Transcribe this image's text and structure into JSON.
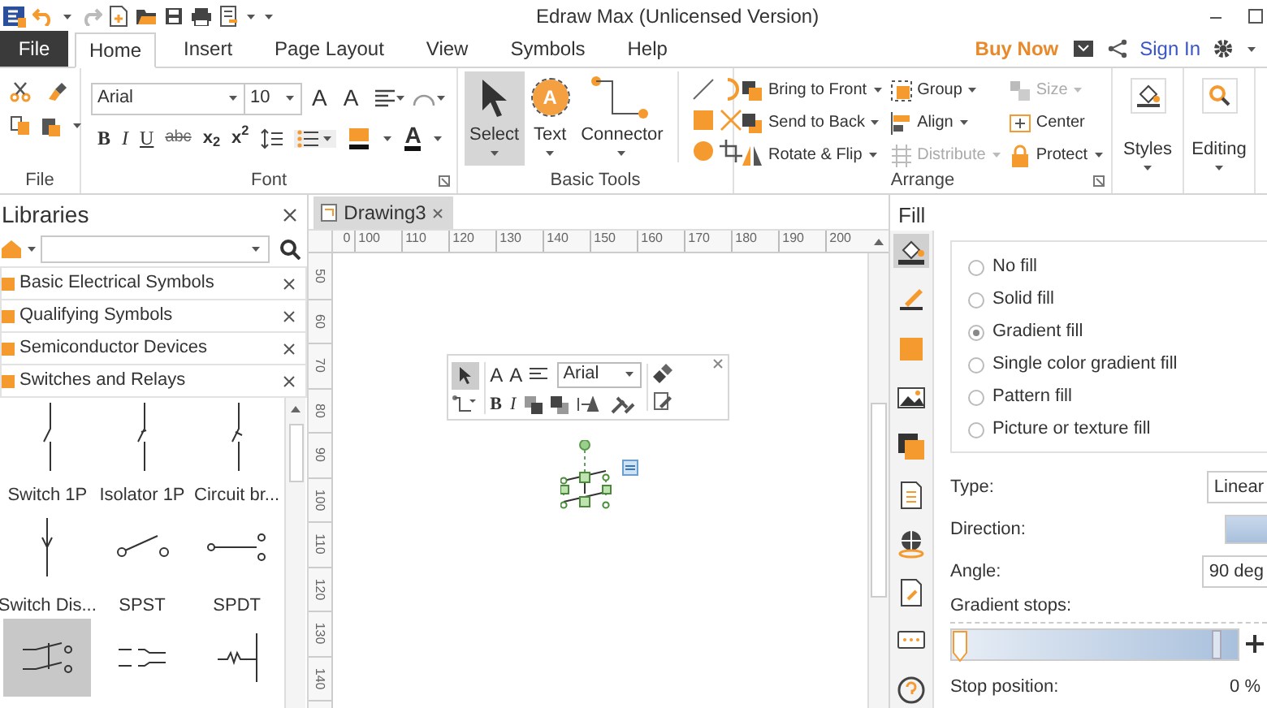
{
  "window": {
    "title": "Edraw Max (Unlicensed Version)"
  },
  "menu_tabs": [
    {
      "label": "File",
      "kind": "backstage",
      "selected": false
    },
    {
      "label": "Home",
      "kind": "tab",
      "selected": true
    },
    {
      "label": "Insert",
      "kind": "tab",
      "selected": false
    },
    {
      "label": "Page Layout",
      "kind": "tab",
      "selected": false
    },
    {
      "label": "View",
      "kind": "tab",
      "selected": false
    },
    {
      "label": "Symbols",
      "kind": "tab",
      "selected": false
    },
    {
      "label": "Help",
      "kind": "tab",
      "selected": false
    }
  ],
  "account": {
    "buy_now": "Buy Now",
    "sign_in": "Sign In"
  },
  "clipboard_group": {
    "label": "File"
  },
  "font_group": {
    "label": "Font",
    "family": "Arial",
    "size": "10",
    "size_buttons": [
      "A",
      "A"
    ],
    "format_buttons": [
      "B",
      "I",
      "U",
      "abc",
      "x$_{2}$",
      "x$^{2}$"
    ],
    "color_button": "A"
  },
  "basic_tools": {
    "label": "Basic Tools",
    "tools": [
      {
        "label": "Select",
        "kind": "pointer",
        "selected": true
      },
      {
        "label": "Text",
        "kind": "text",
        "glyph": "A",
        "selected": false
      },
      {
        "label": "Connector",
        "kind": "connector",
        "selected": false
      }
    ]
  },
  "arrange": {
    "label": "Arrange",
    "commands": [
      {
        "label": "Bring to Front",
        "dropdown": true,
        "disabled": false
      },
      {
        "label": "Group",
        "dropdown": true,
        "disabled": false
      },
      {
        "label": "Size",
        "dropdown": true,
        "disabled": true
      },
      {
        "label": "Send to Back",
        "dropdown": true,
        "disabled": false
      },
      {
        "label": "Align",
        "dropdown": true,
        "disabled": false
      },
      {
        "label": "Center",
        "dropdown": false,
        "disabled": false
      },
      {
        "label": "Rotate & Flip",
        "dropdown": true,
        "disabled": false
      },
      {
        "label": "Distribute",
        "dropdown": true,
        "disabled": true
      },
      {
        "label": "Protect",
        "dropdown": true,
        "disabled": false
      }
    ]
  },
  "styles": {
    "label": "Styles"
  },
  "editing": {
    "label": "Editing"
  },
  "libraries": {
    "title": "Libraries",
    "categories": [
      "Basic Electrical Symbols",
      "Qualifying Symbols",
      "Semiconductor Devices",
      "Switches and Relays"
    ],
    "shapes": [
      {
        "label": "Switch 1P",
        "selected": false
      },
      {
        "label": "Isolator 1P",
        "selected": false
      },
      {
        "label": "Circuit br...",
        "selected": false
      },
      {
        "label": "Switch Dis...",
        "selected": false
      },
      {
        "label": "SPST",
        "selected": false
      },
      {
        "label": "SPDT",
        "selected": false
      },
      {
        "selected": true
      },
      {
        "selected": false
      },
      {
        "selected": false
      }
    ]
  },
  "document_tab": {
    "title": "Drawing3"
  },
  "rulers": {
    "horizontal": [
      "0",
      "100",
      "110",
      "120",
      "130",
      "140",
      "150",
      "160",
      "170",
      "180",
      "190",
      "200"
    ],
    "vertical": [
      "50",
      "60",
      "70",
      "80",
      "90",
      "100",
      "110",
      "120",
      "130",
      "140"
    ]
  },
  "floating_toolbar": {
    "size_buttons": [
      "A",
      "A"
    ],
    "font": "Arial",
    "format_buttons": [
      "B",
      "I"
    ]
  },
  "fill_panel": {
    "title": "Fill",
    "side_tabs": [
      {
        "selected": true
      },
      {
        "selected": false
      },
      {
        "selected": false
      },
      {
        "selected": false
      },
      {
        "selected": false
      },
      {
        "selected": false
      },
      {
        "selected": false
      },
      {
        "selected": false
      },
      {
        "selected": false
      },
      {
        "selected": false
      }
    ],
    "options": [
      {
        "label": "No fill",
        "selected": false
      },
      {
        "label": "Solid fill",
        "selected": false
      },
      {
        "label": "Gradient fill",
        "selected": true
      },
      {
        "label": "Single color gradient fill",
        "selected": false
      },
      {
        "label": "Pattern fill",
        "selected": false
      },
      {
        "label": "Picture or texture fill",
        "selected": false
      }
    ],
    "stop_slider": {
      "level": 0
    },
    "type_label": "Type:",
    "type_value": "Linear",
    "direction_label": "Direction:",
    "angle_label": "Angle:",
    "angle_value": "90 deg",
    "stops_label": "Gradient stops:",
    "stop_position_label": "Stop position:",
    "stop_position_value": "0 %"
  }
}
